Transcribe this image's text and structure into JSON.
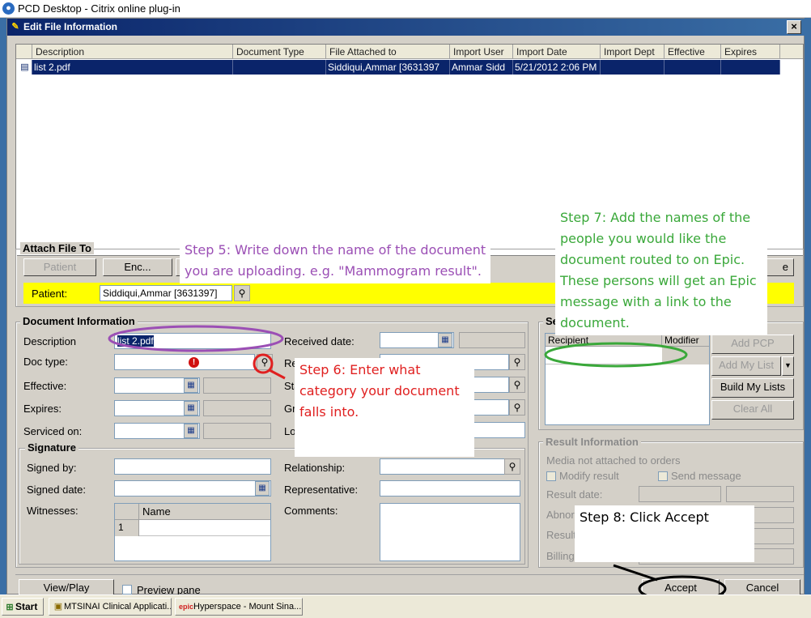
{
  "outer_window": {
    "title": "PCD Desktop - Citrix online plug-in"
  },
  "dialog": {
    "title": "Edit File Information",
    "close": "×"
  },
  "file_grid": {
    "columns": [
      "Description",
      "Document Type",
      "File Attached to",
      "Import User",
      "Import Date",
      "Import Dept",
      "Effective",
      "Expires"
    ],
    "rows": [
      [
        "list 2.pdf",
        "",
        "Siddiqui,Ammar [3631397",
        "Ammar Sidd",
        "5/21/2012 2:06 PM",
        "",
        "",
        ""
      ]
    ]
  },
  "attach_file_to": {
    "label": "Attach File To",
    "buttons": {
      "patient": "Patient",
      "enc": "Enc...",
      "e": "e"
    },
    "patient_label": "Patient:",
    "patient_value": "Siddiqui,Ammar [3631397]"
  },
  "document_information": {
    "label": "Document Information",
    "description_label": "Description",
    "description_value": "list 2.pdf",
    "doc_type_label": "Doc type:",
    "effective_label": "Effective:",
    "expires_label": "Expires:",
    "serviced_on_label": "Serviced on:",
    "received_date_label": "Received date:",
    "re_label": "Re",
    "sta_label": "Sta",
    "gro_label": "Gro",
    "loc_label": "Loc"
  },
  "signature": {
    "label": "Signature",
    "signed_by_label": "Signed by:",
    "signed_date_label": "Signed date:",
    "witnesses_label": "Witnesses:",
    "witness_col": "Name",
    "witness_row_num": "1",
    "relationship_label": "Relationship:",
    "representative_label": "Representative:",
    "comments_label": "Comments:"
  },
  "send": {
    "label": "Se",
    "columns": [
      "Recipient",
      "Modifier"
    ],
    "buttons": {
      "add_pcp": "Add PCP",
      "add_my_list": "Add My List",
      "build_my_lists": "Build My Lists",
      "clear_all": "Clear All"
    }
  },
  "result_information": {
    "label": "Result Information",
    "media_note": "Media not attached to orders",
    "modify_result": "Modify result",
    "send_message": "Send message",
    "result_date_label": "Result date:",
    "abnormal_label": "Abnor",
    "result_label": "Result",
    "billing_label": "Billing"
  },
  "bottom": {
    "view_play": "View/Play",
    "preview_pane": "Preview pane",
    "accept": "Accept",
    "cancel": "Cancel"
  },
  "annotations": {
    "step5": [
      "Step 5: Write down the name of the document",
      "you are uploading. e.g. \"Mammogram result\"."
    ],
    "step6": [
      "Step 6: Enter what",
      "category your document",
      "falls into."
    ],
    "step7": [
      "Step 7: Add the names of the",
      "people you would like the",
      "document routed to on Epic.",
      "These persons will get an Epic",
      "message with a link to the",
      "document."
    ],
    "step8": "Step 8: Click Accept"
  },
  "taskbar": {
    "start": "Start",
    "items": [
      "MTSINAI Clinical Applicati...",
      "Hyperspace - Mount Sina..."
    ]
  },
  "colors": {
    "patient_bar": "#ffff00",
    "step5": "#9b4fb5",
    "step6": "#e02020",
    "step7": "#3aa83a",
    "selection": "#0a246a"
  }
}
